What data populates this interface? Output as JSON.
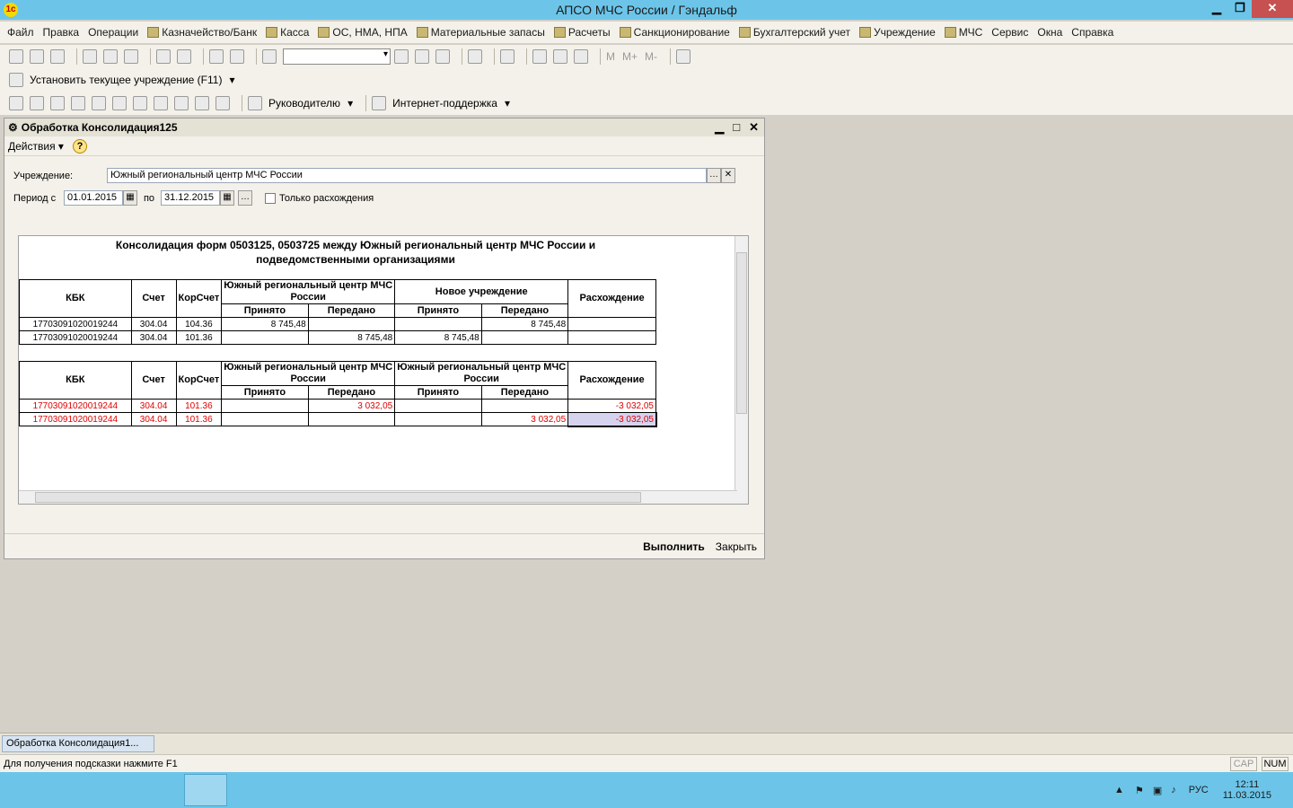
{
  "window": {
    "title": "АПСО МЧС России / Гэндальф",
    "logo_text": "1c"
  },
  "menu": [
    "Файл",
    "Правка",
    "Операции",
    "Казначейство/Банк",
    "Касса",
    "ОС, НМА, НПА",
    "Материальные запасы",
    "Расчеты",
    "Санкционирование",
    "Бухгалтерский учет",
    "Учреждение",
    "МЧС",
    "Сервис",
    "Окна",
    "Справка"
  ],
  "toolbar3": {
    "set_institution": "Установить текущее учреждение (F11)"
  },
  "toolbar4": {
    "manager": "Руководителю",
    "support": "Интернет-поддержка"
  },
  "child": {
    "title": "Обработка  Консолидация125",
    "actions": "Действия",
    "institution_label": "Учреждение:",
    "institution_value": "Южный региональный центр МЧС России",
    "period_label": "Период с",
    "date_from": "01.01.2015",
    "to_label": "по",
    "date_to": "31.12.2015",
    "only_diff": "Только расхождения",
    "run_button": "Выполнить",
    "close_button": "Закрыть"
  },
  "report": {
    "title_line1": "Консолидация форм 0503125, 0503725 между Южный региональный центр МЧС России и",
    "title_line2": "подведомственными организациями",
    "headers": {
      "kbk": "КБК",
      "account": "Счет",
      "cor": "КорСчет",
      "diff": "Расхождение",
      "accepted": "Принято",
      "transferred": "Передано"
    },
    "table1": {
      "group1": "Южный региональный центр МЧС России",
      "group2": "Новое учреждение",
      "rows": [
        {
          "kbk": "17703091020019244",
          "acc": "304.04",
          "cor": "104.36",
          "a1": "8 745,48",
          "t1": "",
          "a2": "",
          "t2": "8 745,48",
          "diff": ""
        },
        {
          "kbk": "17703091020019244",
          "acc": "304.04",
          "cor": "101.36",
          "a1": "",
          "t1": "8 745,48",
          "a2": "8 745,48",
          "t2": "",
          "diff": ""
        }
      ]
    },
    "table2": {
      "group1": "Южный региональный центр МЧС России",
      "group2": "Южный региональный центр МЧС России",
      "rows": [
        {
          "kbk": "17703091020019244",
          "acc": "304.04",
          "cor": "101.36",
          "a1": "",
          "t1": "3 032,05",
          "a2": "",
          "t2": "",
          "diff": "-3 032,05"
        },
        {
          "kbk": "17703091020019244",
          "acc": "304.04",
          "cor": "101.36",
          "a1": "",
          "t1": "",
          "a2": "",
          "t2": "3 032,05",
          "diff": "-3 032,05"
        }
      ]
    }
  },
  "taskpanel": {
    "tab": "Обработка  Консолидация1..."
  },
  "status": {
    "hint": "Для получения подсказки нажмите F1",
    "cap": "CAP",
    "num": "NUM"
  },
  "tray": {
    "lang": "РУС",
    "time": "12:11",
    "date": "11.03.2015"
  }
}
